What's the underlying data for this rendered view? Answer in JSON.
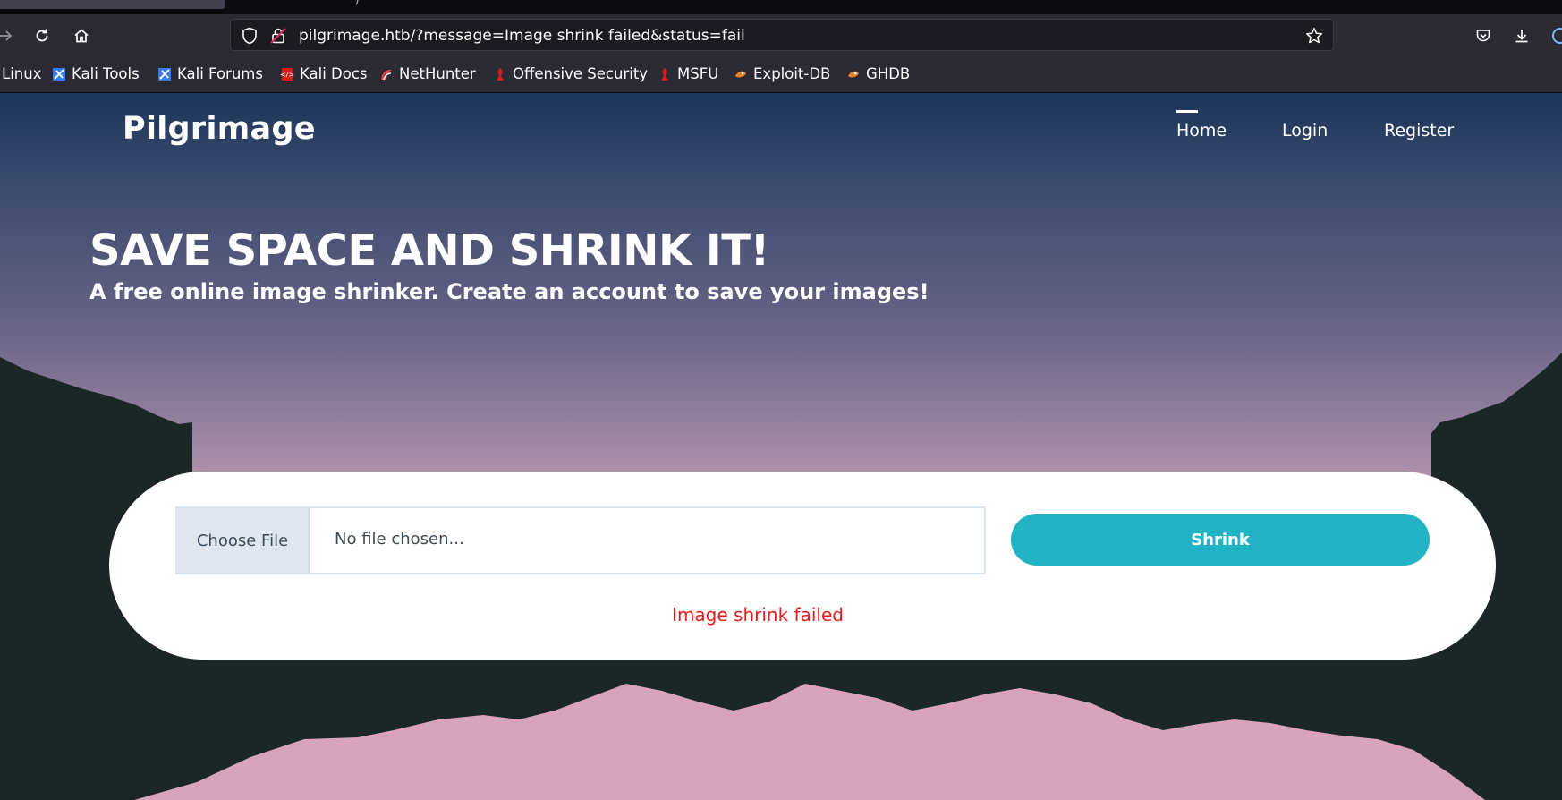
{
  "browser": {
    "tab_label": "/",
    "url": "pilgrimage.htb/?message=Image shrink failed&status=fail",
    "bookmarks": [
      {
        "label": "Linux",
        "icon": "kali-dragon-icon"
      },
      {
        "label": "Kali Tools",
        "icon": "kali-tools-icon"
      },
      {
        "label": "Kali Forums",
        "icon": "kali-forums-icon"
      },
      {
        "label": "Kali Docs",
        "icon": "kali-docs-icon"
      },
      {
        "label": "NetHunter",
        "icon": "nethunter-icon"
      },
      {
        "label": "Offensive Security",
        "icon": "offsec-icon"
      },
      {
        "label": "MSFU",
        "icon": "msfu-icon"
      },
      {
        "label": "Exploit-DB",
        "icon": "exploitdb-icon"
      },
      {
        "label": "GHDB",
        "icon": "ghdb-icon"
      }
    ]
  },
  "site": {
    "brand": "Pilgrimage",
    "nav": {
      "home": "Home",
      "login": "Login",
      "register": "Register",
      "active": "Home"
    }
  },
  "hero": {
    "title": "SAVE SPACE AND SHRINK IT!",
    "subtitle": "A free online image shrinker. Create an account to save your images!"
  },
  "upload_form": {
    "choose_file_label": "Choose File",
    "file_status": "No file chosen...",
    "submit_label": "Shrink",
    "message": "Image shrink failed",
    "message_color": "#e21d1d"
  },
  "colors": {
    "accent": "#22b4c4",
    "sky_top": "#1c3558",
    "sky_bottom": "#c8a3b5",
    "mountain_dark": "#1b2627",
    "mountain_pink": "#d8a4bd"
  }
}
